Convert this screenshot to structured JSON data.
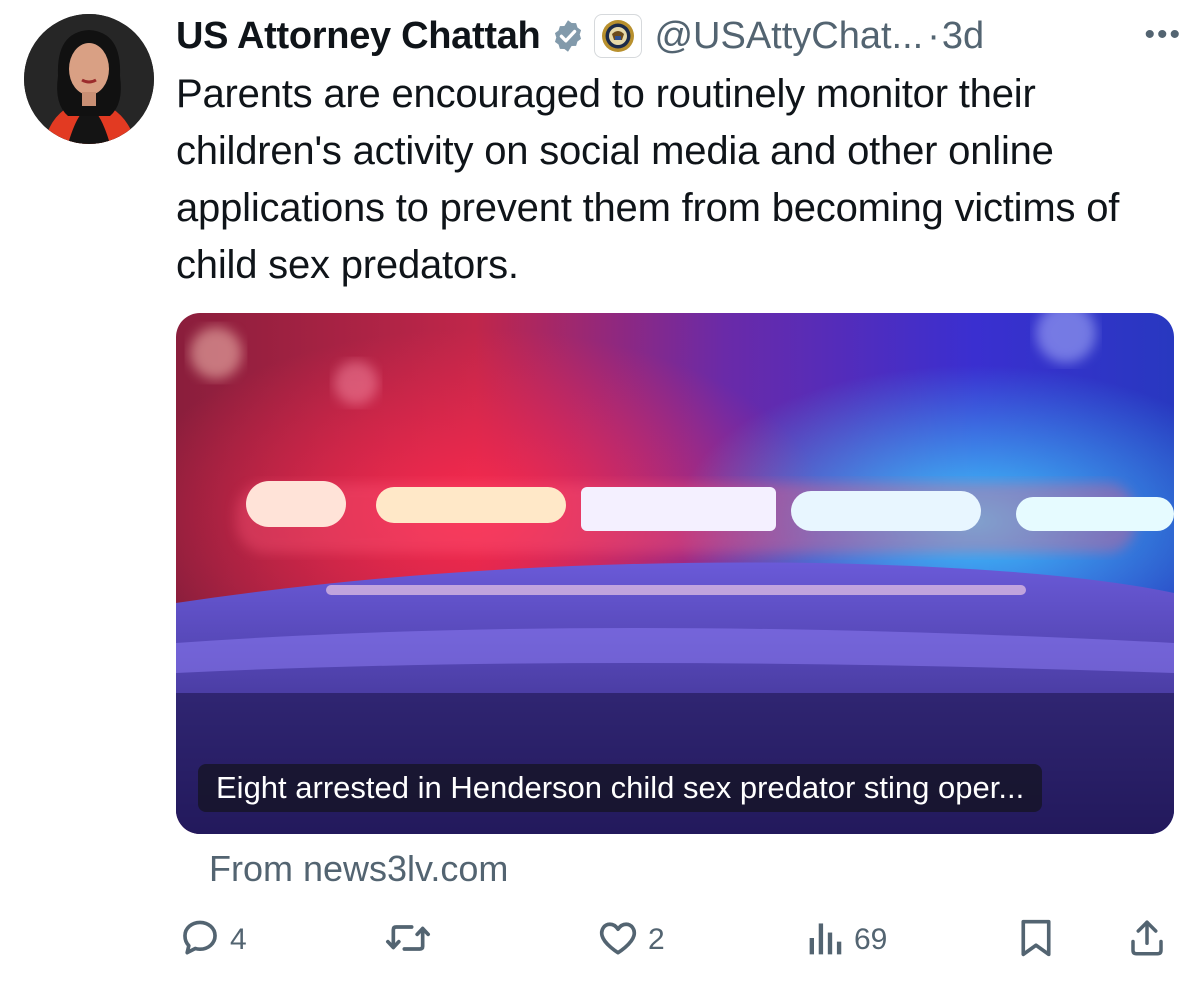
{
  "tweet": {
    "display_name": "US Attorney Chattah",
    "handle": "@USAttyChat...",
    "separator": "·",
    "time": "3d",
    "more_label": "•••",
    "text": "Parents are encouraged to routinely monitor their children's activity on social media and other online applications to prevent them from becoming victims of child sex predators."
  },
  "card": {
    "title": "Eight arrested in Henderson child sex predator sting oper...",
    "source": "From news3lv.com"
  },
  "actions": {
    "replies": "4",
    "reposts": "",
    "likes": "2",
    "views": "69"
  },
  "icons": {
    "verified": "verified-badge-icon",
    "affiliation": "doj-seal-icon",
    "reply": "reply-icon",
    "repost": "repost-icon",
    "like": "heart-icon",
    "views": "views-icon",
    "bookmark": "bookmark-icon",
    "share": "share-icon"
  },
  "colors": {
    "text": "#0f1419",
    "secondary": "#536471",
    "verified": "#829aab"
  }
}
